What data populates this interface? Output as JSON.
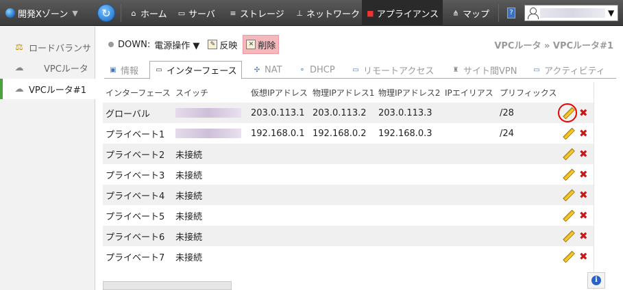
{
  "topbar": {
    "zone_label": "開発Xゾーン",
    "nav": [
      {
        "label": "ホーム",
        "icon": "home-icon"
      },
      {
        "label": "サーバ",
        "icon": "monitor-icon"
      },
      {
        "label": "ストレージ",
        "icon": "storage-icon"
      },
      {
        "label": "ネットワーク",
        "icon": "network-icon"
      },
      {
        "label": "アプライアンス",
        "icon": "appliance-icon"
      },
      {
        "label": "マップ",
        "icon": "map-icon"
      }
    ],
    "active_nav": "アプライアンス"
  },
  "sidebar": {
    "items": [
      {
        "label": "ロードバランサ",
        "icon": "balance-icon"
      },
      {
        "label": "VPCルータ",
        "icon": "cloud-icon"
      },
      {
        "label": "VPCルータ#1",
        "icon": "cloud-icon"
      }
    ]
  },
  "toolbar": {
    "status": "DOWN:",
    "power_label": "電源操作 ▼",
    "apply_label": "反映",
    "delete_label": "削除"
  },
  "breadcrumb": "VPCルータ » VPCルータ#1",
  "tabs": [
    {
      "label": "情報",
      "icon": "info-card-icon"
    },
    {
      "label": "インターフェース",
      "icon": "monitor-icon"
    },
    {
      "label": "NAT",
      "icon": "nat-icon"
    },
    {
      "label": "DHCP",
      "icon": "dhcp-icon"
    },
    {
      "label": "リモートアクセス",
      "icon": "remote-access-icon"
    },
    {
      "label": "サイト間VPN",
      "icon": "vpn-icon"
    },
    {
      "label": "アクティビティ",
      "icon": "activity-icon"
    }
  ],
  "active_tab": "インターフェース",
  "table": {
    "columns": [
      "インターフェース",
      "スイッチ",
      "仮想IPアドレス",
      "物理IPアドレス1",
      "物理IPアドレス2",
      "IPエイリアス",
      "プリフィックス"
    ],
    "rows": [
      {
        "iface": "グローバル",
        "switch": "",
        "vip": "203.0.113.1",
        "ip1": "203.0.113.2",
        "ip2": "203.0.113.3",
        "alias": "",
        "prefix": "/28"
      },
      {
        "iface": "プライベート1",
        "switch": "",
        "vip": "192.168.0.1",
        "ip1": "192.168.0.2",
        "ip2": "192.168.0.3",
        "alias": "",
        "prefix": "/24"
      },
      {
        "iface": "プライベート2",
        "switch": "未接続",
        "vip": "",
        "ip1": "",
        "ip2": "",
        "alias": "",
        "prefix": ""
      },
      {
        "iface": "プライベート3",
        "switch": "未接続",
        "vip": "",
        "ip1": "",
        "ip2": "",
        "alias": "",
        "prefix": ""
      },
      {
        "iface": "プライベート4",
        "switch": "未接続",
        "vip": "",
        "ip1": "",
        "ip2": "",
        "alias": "",
        "prefix": ""
      },
      {
        "iface": "プライベート5",
        "switch": "未接続",
        "vip": "",
        "ip1": "",
        "ip2": "",
        "alias": "",
        "prefix": ""
      },
      {
        "iface": "プライベート6",
        "switch": "未接続",
        "vip": "",
        "ip1": "",
        "ip2": "",
        "alias": "",
        "prefix": ""
      },
      {
        "iface": "プライベート7",
        "switch": "未接続",
        "vip": "",
        "ip1": "",
        "ip2": "",
        "alias": "",
        "prefix": ""
      }
    ]
  },
  "colors": {
    "topbar": "#444444",
    "active_sidebar_accent": "#4aa23c",
    "delete_button_bg": "#f5b8bc",
    "highlight_ring": "#ee0000",
    "delete_icon": "#c81818"
  }
}
